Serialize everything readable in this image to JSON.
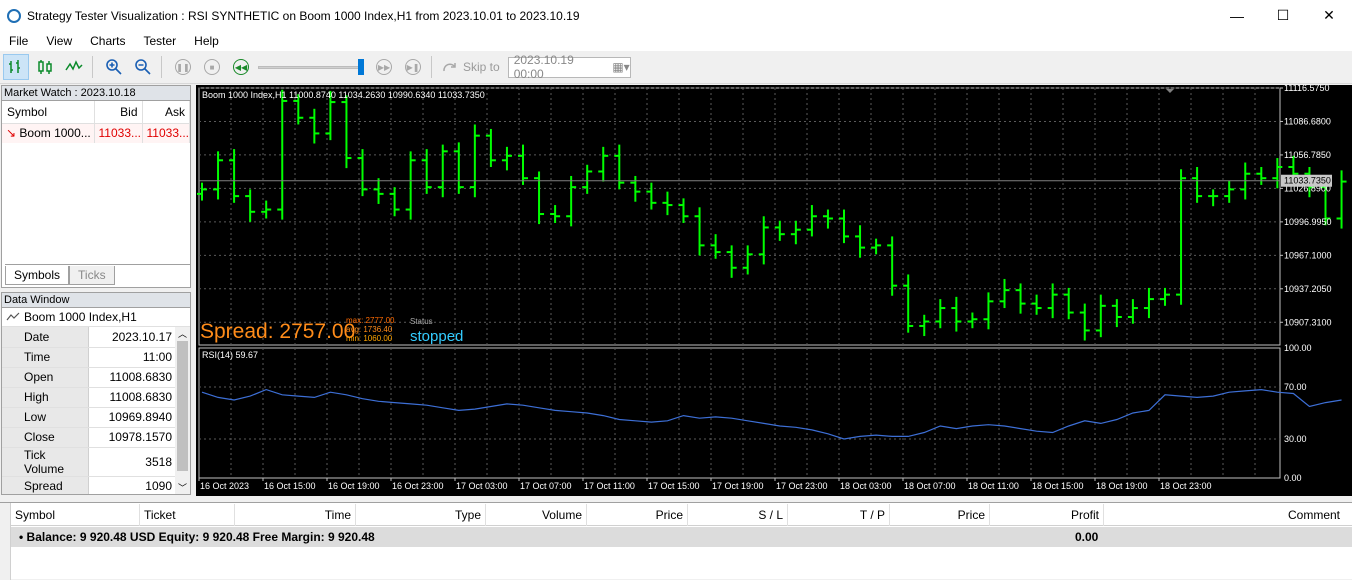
{
  "window": {
    "title": "Strategy Tester Visualization : RSI SYNTHETIC on Boom 1000 Index,H1 from 2023.10.01 to 2023.10.19",
    "minimize": "—",
    "maximize": "☐",
    "close": "✕"
  },
  "menu": [
    "File",
    "View",
    "Charts",
    "Tester",
    "Help"
  ],
  "toolbar": {
    "skip_label": "Skip to",
    "skip_date": "2023.10.19 00:00"
  },
  "market_watch": {
    "title": "Market Watch : 2023.10.18",
    "columns": [
      "Symbol",
      "Bid",
      "Ask"
    ],
    "rows": [
      {
        "symbol": "Boom 1000...",
        "bid": "11033...",
        "ask": "11033..."
      }
    ],
    "tabs": [
      "Symbols",
      "Ticks"
    ]
  },
  "data_window": {
    "title": "Data Window",
    "symbol": "Boom 1000 Index,H1",
    "rows": [
      {
        "k": "Date",
        "v": "2023.10.17"
      },
      {
        "k": "Time",
        "v": "11:00"
      },
      {
        "k": "Open",
        "v": "11008.6830"
      },
      {
        "k": "High",
        "v": "11008.6830"
      },
      {
        "k": "Low",
        "v": "10969.8940"
      },
      {
        "k": "Close",
        "v": "10978.1570"
      },
      {
        "k": "Tick Volume",
        "v": "3518"
      },
      {
        "k": "Spread",
        "v": "1090"
      }
    ]
  },
  "chart": {
    "header": "Boom 1000 Index,H1  11000.8740 11034.2630 10990.6340 11033.7350",
    "spread_text": "Spread: 2757.00",
    "max_text": "max: 2777.00",
    "avg_text": "avg: 1736.40",
    "min_text": "min: 1060.00",
    "status_label": "Status",
    "status_value": "stopped",
    "current_price": "11033.7350",
    "price_axis": [
      "11116.5750",
      "11086.6800",
      "11056.7850",
      "11026.8900",
      "10996.9950",
      "10967.1000",
      "10937.2050",
      "10907.3100"
    ],
    "rsi_label": "RSI(14) 59.67",
    "rsi_axis": [
      "100.00",
      "70.00",
      "30.00",
      "0.00"
    ],
    "time_axis": [
      "16 Oct 2023",
      "16 Oct 15:00",
      "16 Oct 19:00",
      "16 Oct 23:00",
      "17 Oct 03:00",
      "17 Oct 07:00",
      "17 Oct 11:00",
      "17 Oct 15:00",
      "17 Oct 19:00",
      "17 Oct 23:00",
      "18 Oct 03:00",
      "18 Oct 07:00",
      "18 Oct 11:00",
      "18 Oct 15:00",
      "18 Oct 19:00",
      "18 Oct 23:00"
    ],
    "bar_color": "#00ff00",
    "rsi_color": "#3d6fd6"
  },
  "chart_data": {
    "type": "ohlc",
    "close": [
      11026,
      11052,
      11020,
      11006,
      11008,
      11105,
      11090,
      11076,
      11104,
      11054,
      11026,
      11022,
      11008,
      11052,
      11028,
      11060,
      11028,
      11074,
      11052,
      11056,
      11036,
      11004,
      11002,
      11028,
      11042,
      11056,
      11032,
      11024,
      11014,
      11012,
      11002,
      10976,
      10970,
      10956,
      10968,
      10992,
      10986,
      10990,
      11002,
      11000,
      10984,
      10974,
      10976,
      10940,
      10904,
      10908,
      10920,
      10908,
      10910,
      10926,
      10936,
      10924,
      10920,
      10932,
      10916,
      10900,
      10922,
      10912,
      10920,
      10928,
      10932,
      11036,
      11020,
      11020,
      11026,
      11040,
      11036,
      11046,
      11040,
      11028,
      11000,
      11033
    ],
    "rsi": [
      66,
      62,
      60,
      63,
      68,
      64,
      63,
      62,
      66,
      64,
      61,
      59,
      58,
      57,
      56,
      54,
      52,
      53,
      55,
      57,
      56,
      54,
      52,
      51,
      50,
      48,
      45,
      44,
      43,
      44,
      48,
      46,
      47,
      46,
      44,
      42,
      40,
      39,
      37,
      34,
      30,
      32,
      33,
      32,
      32,
      35,
      40,
      38,
      40,
      41,
      40,
      38,
      36,
      35,
      40,
      44,
      42,
      45,
      50,
      52,
      64,
      63,
      62,
      63,
      66,
      67,
      68,
      66,
      65,
      55,
      58,
      60
    ],
    "ylim_price": [
      10887.0,
      11116.575
    ],
    "ylim_rsi": [
      0,
      100
    ]
  },
  "terminal": {
    "columns": [
      "Symbol",
      "Ticket",
      "Time",
      "Type",
      "Volume",
      "Price",
      "S / L",
      "T / P",
      "Price",
      "Profit",
      "Comment"
    ],
    "balance_text": "•  Balance: 9 920.48 USD  Equity: 9 920.48  Free Margin: 9 920.48",
    "profit": "0.00"
  }
}
